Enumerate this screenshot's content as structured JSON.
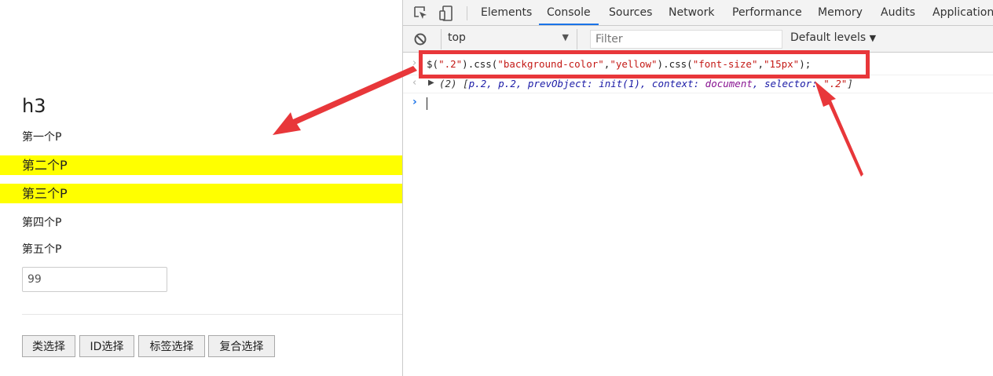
{
  "page": {
    "heading": "h3",
    "paragraphs": [
      "第一个P",
      "第二个P",
      "第三个P",
      "第四个P",
      "第五个P"
    ],
    "input_value": "99",
    "buttons": [
      "类选择",
      "ID选择",
      "标签选择",
      "复合选择"
    ],
    "highlight_color": "#ffff00"
  },
  "devtools": {
    "tabs": [
      "Elements",
      "Console",
      "Sources",
      "Network",
      "Performance",
      "Memory",
      "Audits",
      "Application"
    ],
    "active_tab": "Console",
    "context": "top",
    "filter_placeholder": "Filter",
    "levels": "Default levels",
    "console": {
      "input_parts": [
        "$(",
        "\".2\"",
        ").css(",
        "\"background-color\"",
        ",",
        "\"yellow\"",
        ").css(",
        "\"font-size\"",
        ",",
        "\"15px\"",
        ");"
      ],
      "output": {
        "count": "(2)",
        "open": "[",
        "items": "p.2, p.2, prevObject: init(1), context: ",
        "document": "document",
        "selector_key": ", selector: ",
        "selector_val": "\".2\"",
        "close": "]"
      }
    },
    "accent_color": "#1a73e8"
  },
  "annotation_color": "#e8373a"
}
